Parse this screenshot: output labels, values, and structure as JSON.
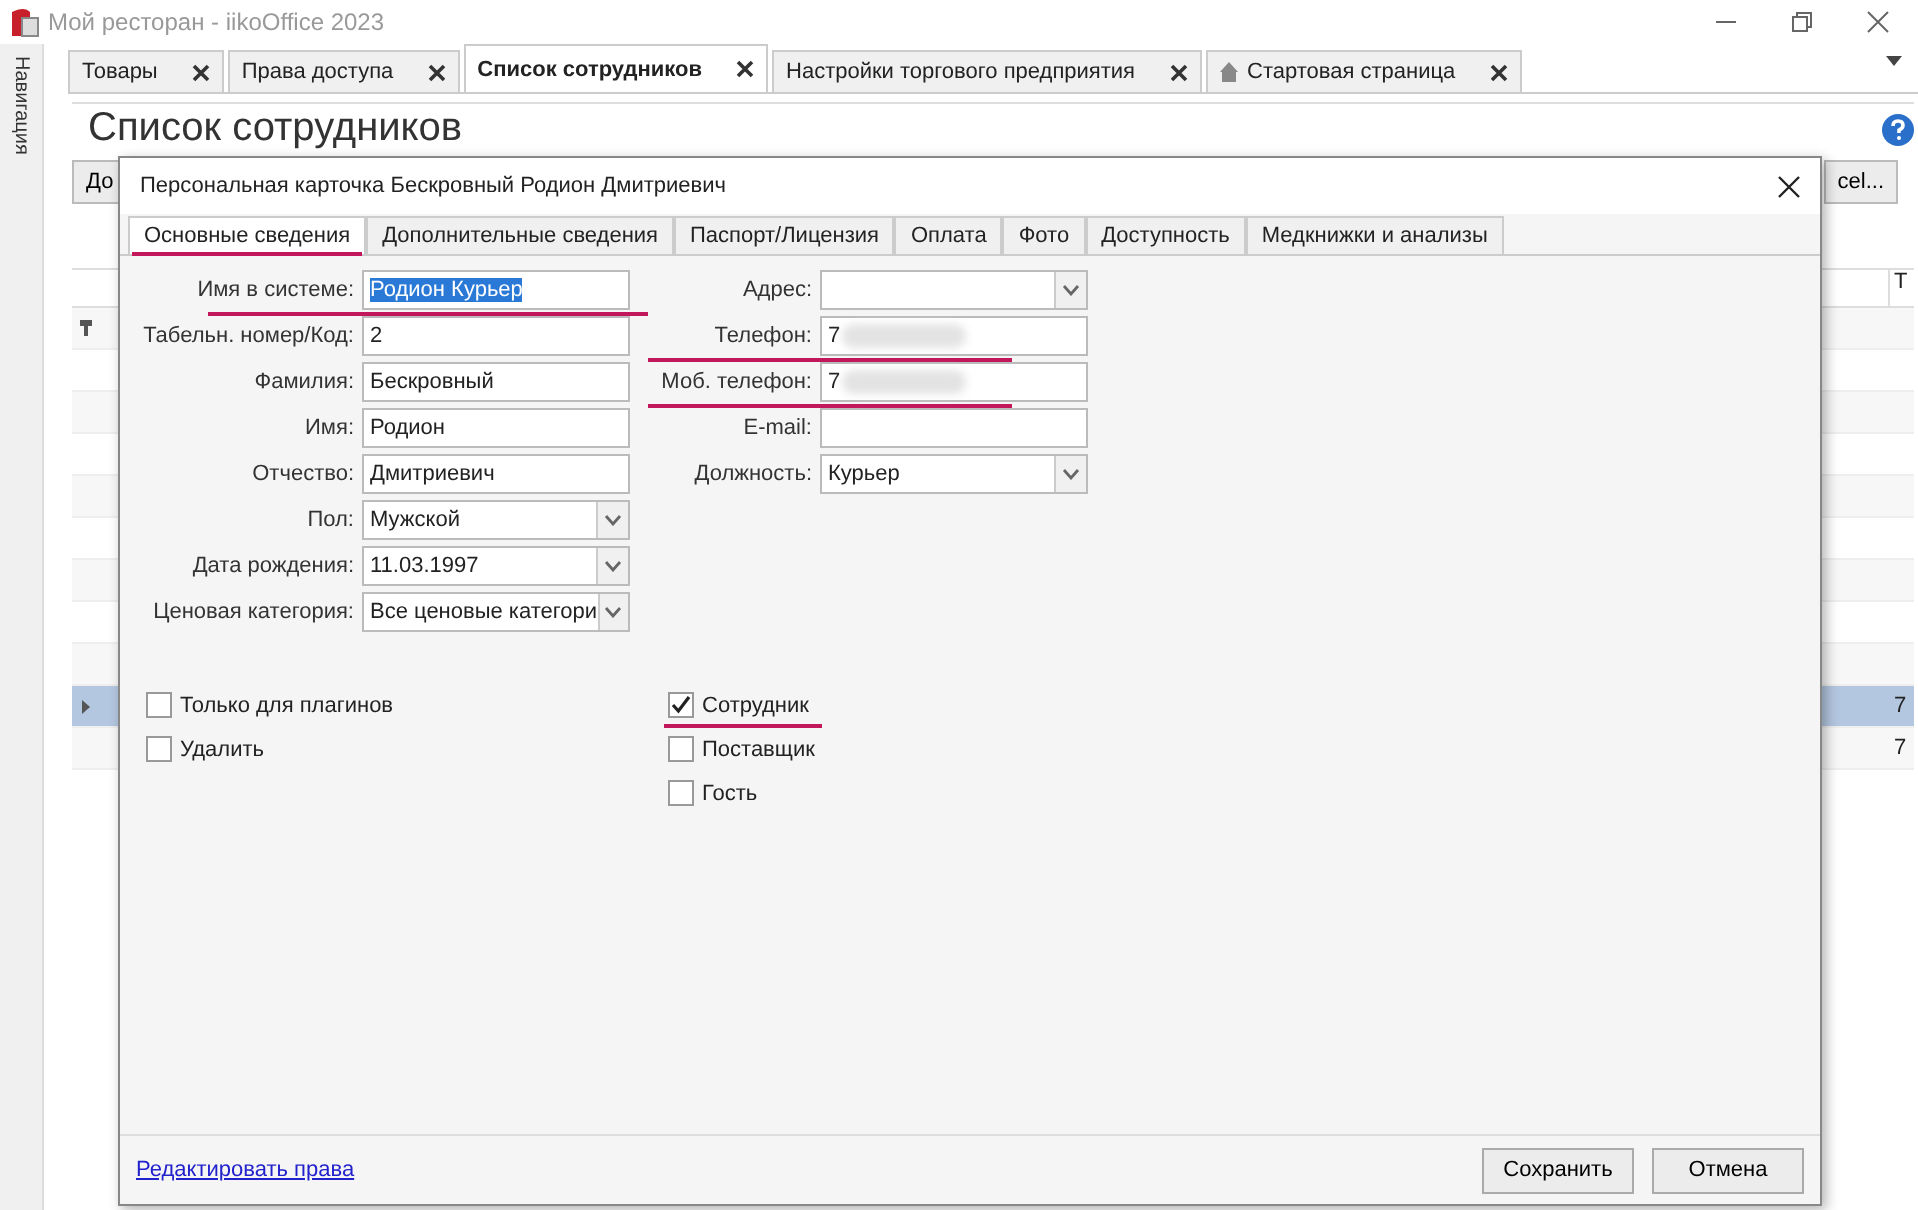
{
  "window": {
    "title": "Мой ресторан - iikoOffice 2023"
  },
  "sidebar": {
    "label": "Навигация"
  },
  "tabs": [
    {
      "label": "Товары",
      "selected": false
    },
    {
      "label": "Права доступа",
      "selected": false
    },
    {
      "label": "Список сотрудников",
      "selected": true
    },
    {
      "label": "Настройки торгового предприятия",
      "selected": false
    },
    {
      "label": "Стартовая страница",
      "selected": false,
      "icon": true
    }
  ],
  "page": {
    "title": "Список сотрудников",
    "left_button": "До",
    "right_button": "cel...",
    "column_header": "Т",
    "rows": [
      {
        "kind": "filter",
        "selected": false
      },
      {
        "kind": "data",
        "selected": false
      },
      {
        "kind": "data",
        "selected": false
      },
      {
        "kind": "data",
        "selected": false
      },
      {
        "kind": "data",
        "selected": false
      },
      {
        "kind": "data",
        "selected": false
      },
      {
        "kind": "data",
        "selected": false
      },
      {
        "kind": "data",
        "selected": false
      },
      {
        "kind": "data",
        "selected": false
      },
      {
        "kind": "data",
        "selected": true,
        "cell": "7"
      },
      {
        "kind": "data",
        "selected": false,
        "cell": "7"
      }
    ]
  },
  "dialog": {
    "title": "Персональная карточка Бескровный Родион Дмитриевич",
    "tabs": [
      {
        "label": "Основные сведения",
        "selected": true,
        "underlined": true
      },
      {
        "label": "Дополнительные сведения",
        "selected": false
      },
      {
        "label": "Паспорт/Лицензия",
        "selected": false
      },
      {
        "label": "Оплата",
        "selected": false
      },
      {
        "label": "Фото",
        "selected": false
      },
      {
        "label": "Доступность",
        "selected": false
      },
      {
        "label": "Медкнижки и анализы",
        "selected": false
      }
    ],
    "left_fields": [
      {
        "label": "Имя в системе:",
        "kind": "text",
        "value": "Родион Курьер",
        "text_selected": true,
        "underlined": true
      },
      {
        "label": "Табельн. номер/Код:",
        "kind": "text",
        "value": "2"
      },
      {
        "label": "Фамилия:",
        "kind": "text",
        "value": "Бескровный"
      },
      {
        "label": "Имя:",
        "kind": "text",
        "value": "Родион"
      },
      {
        "label": "Отчество:",
        "kind": "text",
        "value": "Дмитриевич"
      },
      {
        "label": "Пол:",
        "kind": "dropdown",
        "value": "Мужской"
      },
      {
        "label": "Дата рождения:",
        "kind": "dropdown",
        "value": "11.03.1997"
      },
      {
        "label": "Ценовая категория:",
        "kind": "dropdown",
        "value": "Все ценовые категори"
      }
    ],
    "right_fields": [
      {
        "label": "Адрес:",
        "kind": "dropdown"
      },
      {
        "label": "Телефон:",
        "kind": "text",
        "value": "7",
        "underlined": true,
        "redacted": true
      },
      {
        "label": "Моб. телефон:",
        "kind": "text",
        "value": "7",
        "underlined": true,
        "redacted": true
      },
      {
        "label": "E-mail:",
        "kind": "text"
      },
      {
        "label": "Должность:",
        "kind": "dropdown",
        "value": "Курьер"
      }
    ],
    "left_checks": [
      {
        "label": "Только для плагинов",
        "checked": false
      },
      {
        "label": "Удалить",
        "checked": false
      }
    ],
    "right_checks": [
      {
        "label": "Сотрудник",
        "checked": true,
        "underlined": true
      },
      {
        "label": "Поставщик",
        "checked": false
      },
      {
        "label": "Гость",
        "checked": false
      }
    ],
    "link": "Редактировать права",
    "buttons": [
      "Сохранить",
      "Отмена"
    ]
  }
}
